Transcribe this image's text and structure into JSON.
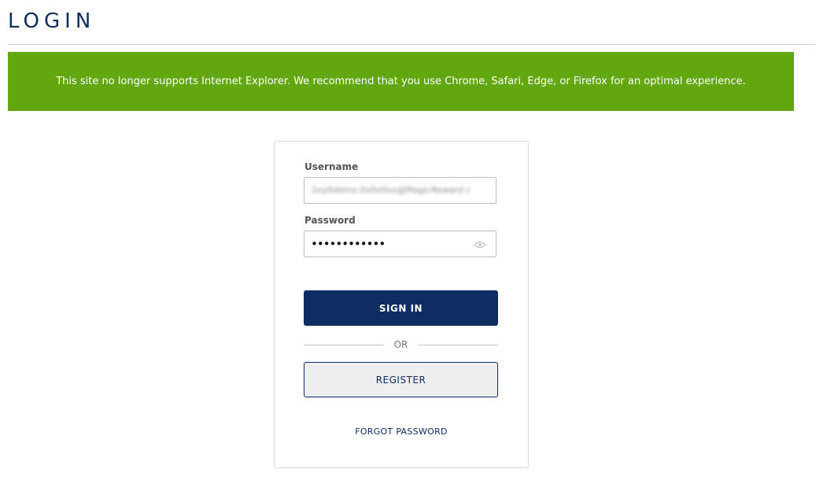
{
  "page": {
    "title": "LOGIN"
  },
  "banner": {
    "message": "This site no longer supports Internet Explorer. We recommend that you use Chrome, Safari, Edge, or Firefox for an optimal experience.",
    "background_color": "#63a70f"
  },
  "form": {
    "username_label": "Username",
    "username_value": "2xy0demo.0x0x0xx@MagicReward.c",
    "password_label": "Password",
    "password_value": "••••••••••••",
    "password_toggle_icon": "eye-icon",
    "sign_in_label": "SIGN IN",
    "or_label": "OR",
    "register_label": "REGISTER",
    "forgot_password_label": "FORGOT PASSWORD"
  },
  "colors": {
    "primary": "#0e2d63",
    "banner": "#63a70f"
  }
}
